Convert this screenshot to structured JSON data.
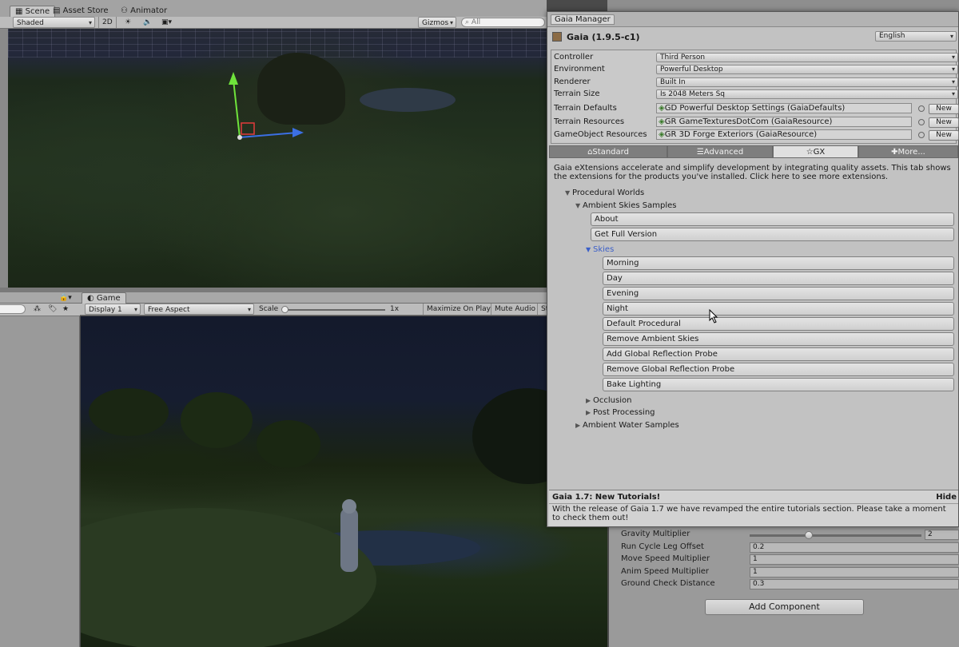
{
  "scene_panel": {
    "tabs": [
      {
        "label": "Scene",
        "icon": "scene-icon"
      },
      {
        "label": "Asset Store",
        "icon": "store-icon"
      },
      {
        "label": "Animator",
        "icon": "animator-icon"
      }
    ],
    "toolbar": {
      "shading_mode": "Shaded",
      "mode_2d": "2D",
      "gizmos": "Gizmos",
      "search_placeholder": "All"
    }
  },
  "game_panel": {
    "tab_label": "Game",
    "display": "Display 1",
    "aspect": "Free Aspect",
    "scale_label": "Scale",
    "scale_value": "1x",
    "maximize_on_play": "Maximize On Play",
    "mute_audio": "Mute Audio",
    "stats_truncated": "St"
  },
  "gaia_manager": {
    "window_title": "Gaia Manager",
    "header_title": "Gaia (1.9.5-c1)",
    "language": "English",
    "settings": [
      {
        "label": "Controller",
        "value": "Third Person"
      },
      {
        "label": "Environment",
        "value": "Powerful Desktop"
      },
      {
        "label": "Renderer",
        "value": "Built In"
      },
      {
        "label": "Terrain Size",
        "value": "Is 2048 Meters Sq"
      }
    ],
    "resources": [
      {
        "label": "Terrain Defaults",
        "value": "GD Powerful Desktop Settings (GaiaDefaults)",
        "button": "New"
      },
      {
        "label": "Terrain Resources",
        "value": "GR GameTexturesDotCom (GaiaResource)",
        "button": "New"
      },
      {
        "label": "GameObject Resources",
        "value": "GR 3D Forge Exteriors (GaiaResource)",
        "button": "New"
      }
    ],
    "tabs": [
      {
        "label": "Standard",
        "icon": "home-icon"
      },
      {
        "label": "Advanced",
        "icon": "list-icon"
      },
      {
        "label": "GX",
        "icon": "star-icon"
      },
      {
        "label": "More...",
        "icon": "plus-icon"
      }
    ],
    "description": "Gaia eXtensions accelerate and simplify development by integrating quality assets. This tab shows the extensions for the products you've installed. Click here to see more extensions.",
    "tree": {
      "procedural_worlds": "Procedural Worlds",
      "ambient_skies_samples": "Ambient Skies Samples",
      "about": "About",
      "get_full_version": "Get Full Version",
      "skies": "Skies",
      "sky_buttons": [
        "Morning",
        "Day",
        "Evening",
        "Night",
        "Default Procedural",
        "Remove Ambient Skies",
        "Add Global Reflection Probe",
        "Remove Global Reflection Probe",
        "Bake Lighting"
      ],
      "occlusion": "Occlusion",
      "post_processing": "Post Processing",
      "ambient_water_samples": "Ambient Water Samples"
    },
    "notice": {
      "title": "Gaia 1.7: New Tutorials!",
      "hide": "Hide",
      "body": "With the release of Gaia 1.7 we have revamped the entire tutorials section. Please take a moment to check them out!"
    }
  },
  "inspector": {
    "gravity_multiplier": {
      "label": "Gravity Multiplier",
      "value": "2"
    },
    "fields": [
      {
        "label": "Run Cycle Leg Offset",
        "value": "0.2"
      },
      {
        "label": "Move Speed Multiplier",
        "value": "1"
      },
      {
        "label": "Anim Speed Multiplier",
        "value": "1"
      },
      {
        "label": "Ground Check Distance",
        "value": "0.3"
      }
    ],
    "add_component": "Add Component"
  },
  "colors": {
    "skies_link": "#3b5fc9",
    "gizmo_y": "#6fe33b",
    "gizmo_x": "#3b6fe3",
    "gizmo_z": "#e33b3b"
  }
}
